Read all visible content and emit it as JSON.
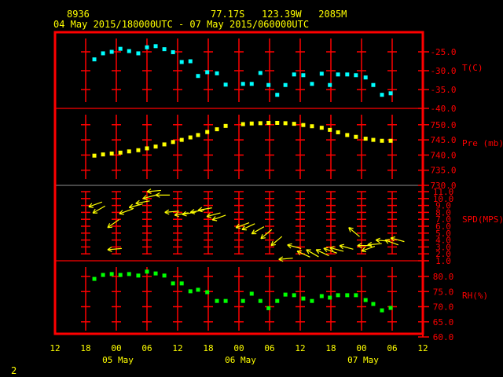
{
  "header": {
    "station_id": "8936",
    "location": "77.17S   123.39W   2085M",
    "time_range": "04 May 2015/180000UTC - 07 May 2015/060000UTC"
  },
  "footer": {
    "page_number": "2"
  },
  "colors": {
    "frame": "#ff0000",
    "text": "#ffff00",
    "temp": "#00ffff",
    "pressure": "#ffff00",
    "wind": "#ffff00",
    "rh": "#00ff00"
  },
  "chart_data": {
    "type": "scatter",
    "x_axis": {
      "unit": "hours since 04 May 2015 12UTC",
      "range": [
        0,
        72
      ],
      "tick_labels": [
        "12",
        "18",
        "00",
        "06",
        "12",
        "18",
        "00",
        "06",
        "12",
        "18",
        "00",
        "06",
        "12"
      ],
      "date_labels": [
        {
          "label": "05 May",
          "hour": 12
        },
        {
          "label": "06 May",
          "hour": 36
        },
        {
          "label": "07 May",
          "hour": 60
        }
      ]
    },
    "hours": [
      7.7,
      9.4,
      11.1,
      12.8,
      14.5,
      16.3,
      18.0,
      19.7,
      21.4,
      23.1,
      24.8,
      26.5,
      28.0,
      29.8,
      31.7,
      33.4,
      36.8,
      38.5,
      40.2,
      41.8,
      43.5,
      45.1,
      46.8,
      48.6,
      50.3,
      52.2,
      53.8,
      55.4,
      57.2,
      58.9,
      60.8,
      62.3,
      64.0,
      65.7
    ],
    "panels": [
      {
        "name": "temperature",
        "label": "T(C)",
        "ylim": [
          -40,
          -22.4
        ],
        "ticks": [
          "-25.0",
          "-30.0",
          "-35.0",
          "-40.0"
        ],
        "tick_values": [
          -25,
          -30,
          -35,
          -40
        ],
        "values": [
          -27.0,
          -25.4,
          -25.0,
          -24.2,
          -24.8,
          -25.4,
          -23.8,
          -23.5,
          -24.3,
          -25.1,
          -27.7,
          -27.5,
          -31.4,
          -30.4,
          -30.7,
          -33.7,
          -33.5,
          -33.5,
          -30.6,
          -33.8,
          -36.4,
          -33.8,
          -31.0,
          -31.2,
          -33.5,
          -30.8,
          -33.8,
          -31.0,
          -31.0,
          -31.2,
          -31.8,
          -33.8,
          -36.4,
          -36.0
        ]
      },
      {
        "name": "pressure",
        "label": "Pre (mb)",
        "ylim": [
          730,
          755.2
        ],
        "ticks": [
          "750.0",
          "745.0",
          "740.0",
          "735.0",
          "730.0"
        ],
        "tick_values": [
          750,
          745,
          740,
          735,
          730
        ],
        "values": [
          739.8,
          740.2,
          740.5,
          740.8,
          741.2,
          741.6,
          742.2,
          742.8,
          743.5,
          744.3,
          745.0,
          745.8,
          746.6,
          747.6,
          748.5,
          749.6,
          750.2,
          750.4,
          750.5,
          750.6,
          750.6,
          750.5,
          750.3,
          749.9,
          749.5,
          749.0,
          748.3,
          747.5,
          746.6,
          746.0,
          745.4,
          745.0,
          744.7,
          744.7
        ]
      },
      {
        "name": "wind_speed",
        "label": "SPD(MPS)",
        "ylim": [
          1,
          12
        ],
        "ticks": [
          "11.0",
          "10.0",
          "9.0",
          "8.0",
          "7.0",
          "6.0",
          "5.0",
          "4.0",
          "3.0",
          "2.0",
          "1.0"
        ],
        "tick_values": [
          11,
          10,
          9,
          8,
          7,
          6,
          5,
          4,
          3,
          2,
          1
        ],
        "wind_hours": [
          0.6,
          1.4,
          4.3,
          4.3,
          6.6,
          8.5,
          9.8,
          11.2,
          12.0,
          13.7,
          15.5,
          17.4,
          18.9,
          20.5,
          22.0,
          23.7,
          24.8,
          29.4,
          30.6,
          32.5,
          34.3,
          36.3,
          37.8,
          39.5,
          41.4,
          43.2,
          45.1,
          46.6,
          47.8,
          49.7,
          51.5,
          53.2,
          54.0,
          55.2,
          56.8,
          58.6,
          59.7
        ],
        "values": [
          8.8,
          7.9,
          5.8,
          2.6,
          7.8,
          8.7,
          9.3,
          10.0,
          11.0,
          10.5,
          8.0,
          7.6,
          7.7,
          8.0,
          8.3,
          7.4,
          6.9,
          5.8,
          5.5,
          4.9,
          4.2,
          3.2,
          1.2,
          3.3,
          2.4,
          2.6,
          2.6,
          2.8,
          2.9,
          3.2,
          5.8,
          3.2,
          2.4,
          3.3,
          4.0,
          4.0,
          4.3
        ],
        "direction_deg": [
          200,
          210,
          215,
          185,
          200,
          195,
          190,
          195,
          185,
          180,
          185,
          190,
          190,
          190,
          190,
          195,
          200,
          200,
          205,
          210,
          220,
          220,
          185,
          165,
          155,
          150,
          155,
          160,
          165,
          165,
          140,
          180,
          200,
          185,
          175,
          160,
          165
        ]
      },
      {
        "name": "relative_humidity",
        "label": "RH(%)",
        "ylim": [
          60,
          85.2
        ],
        "ticks": [
          "80.0",
          "75.0",
          "70.0",
          "65.0",
          "60.0"
        ],
        "tick_values": [
          80,
          75,
          70,
          65,
          60
        ],
        "values": [
          79.2,
          80.5,
          80.8,
          80.5,
          80.8,
          80.3,
          81.6,
          81.0,
          80.3,
          77.7,
          77.7,
          75.1,
          75.6,
          74.8,
          71.9,
          71.9,
          71.9,
          74.3,
          71.9,
          69.5,
          71.9,
          74.0,
          73.8,
          72.7,
          71.9,
          73.5,
          73.0,
          73.8,
          73.8,
          73.8,
          72.2,
          70.9,
          68.8,
          69.6
        ]
      }
    ]
  }
}
